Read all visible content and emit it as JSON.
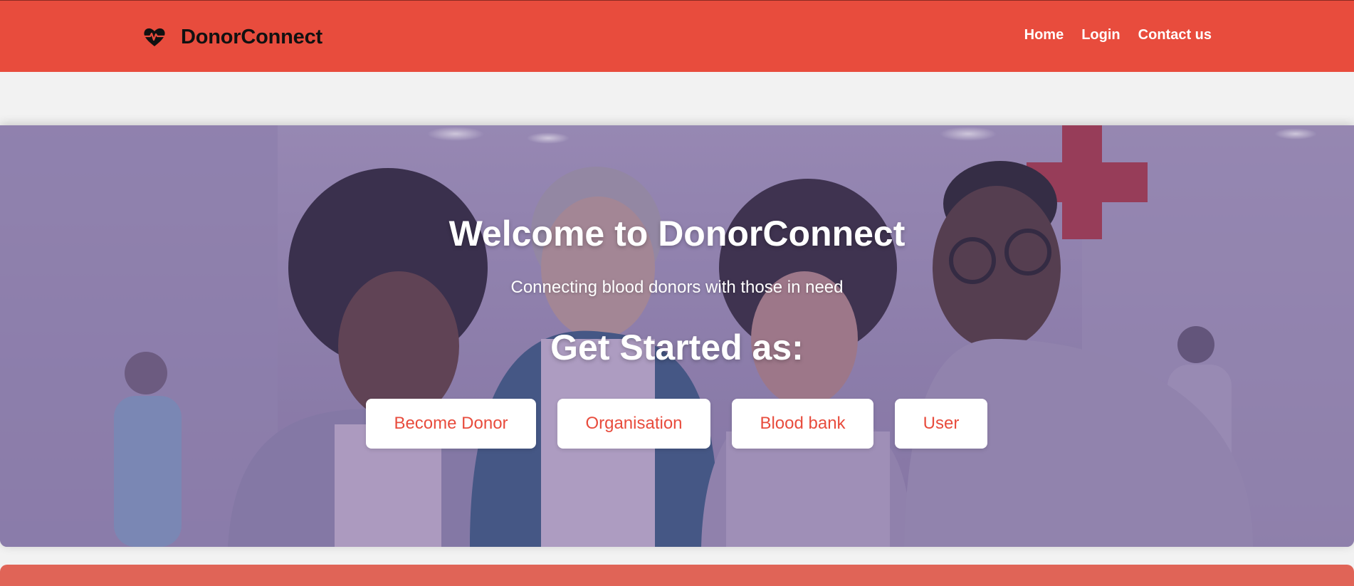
{
  "header": {
    "brand_icon": "heartbeat-icon",
    "brand_name": "DonorConnect",
    "background_color": "#e84c3d",
    "nav": [
      {
        "label": "Home"
      },
      {
        "label": "Login"
      },
      {
        "label": "Contact us"
      }
    ]
  },
  "hero": {
    "title": "Welcome to DonorConnect",
    "subtitle": "Connecting blood donors with those in need",
    "cta_title": "Get Started as:",
    "buttons": [
      {
        "label": "Become Donor"
      },
      {
        "label": "Organisation"
      },
      {
        "label": "Blood bank"
      },
      {
        "label": "User"
      }
    ],
    "button_text_color": "#e84c3d",
    "overlay_color": "#705a96"
  },
  "footer_strip": {
    "color": "#e06457"
  }
}
